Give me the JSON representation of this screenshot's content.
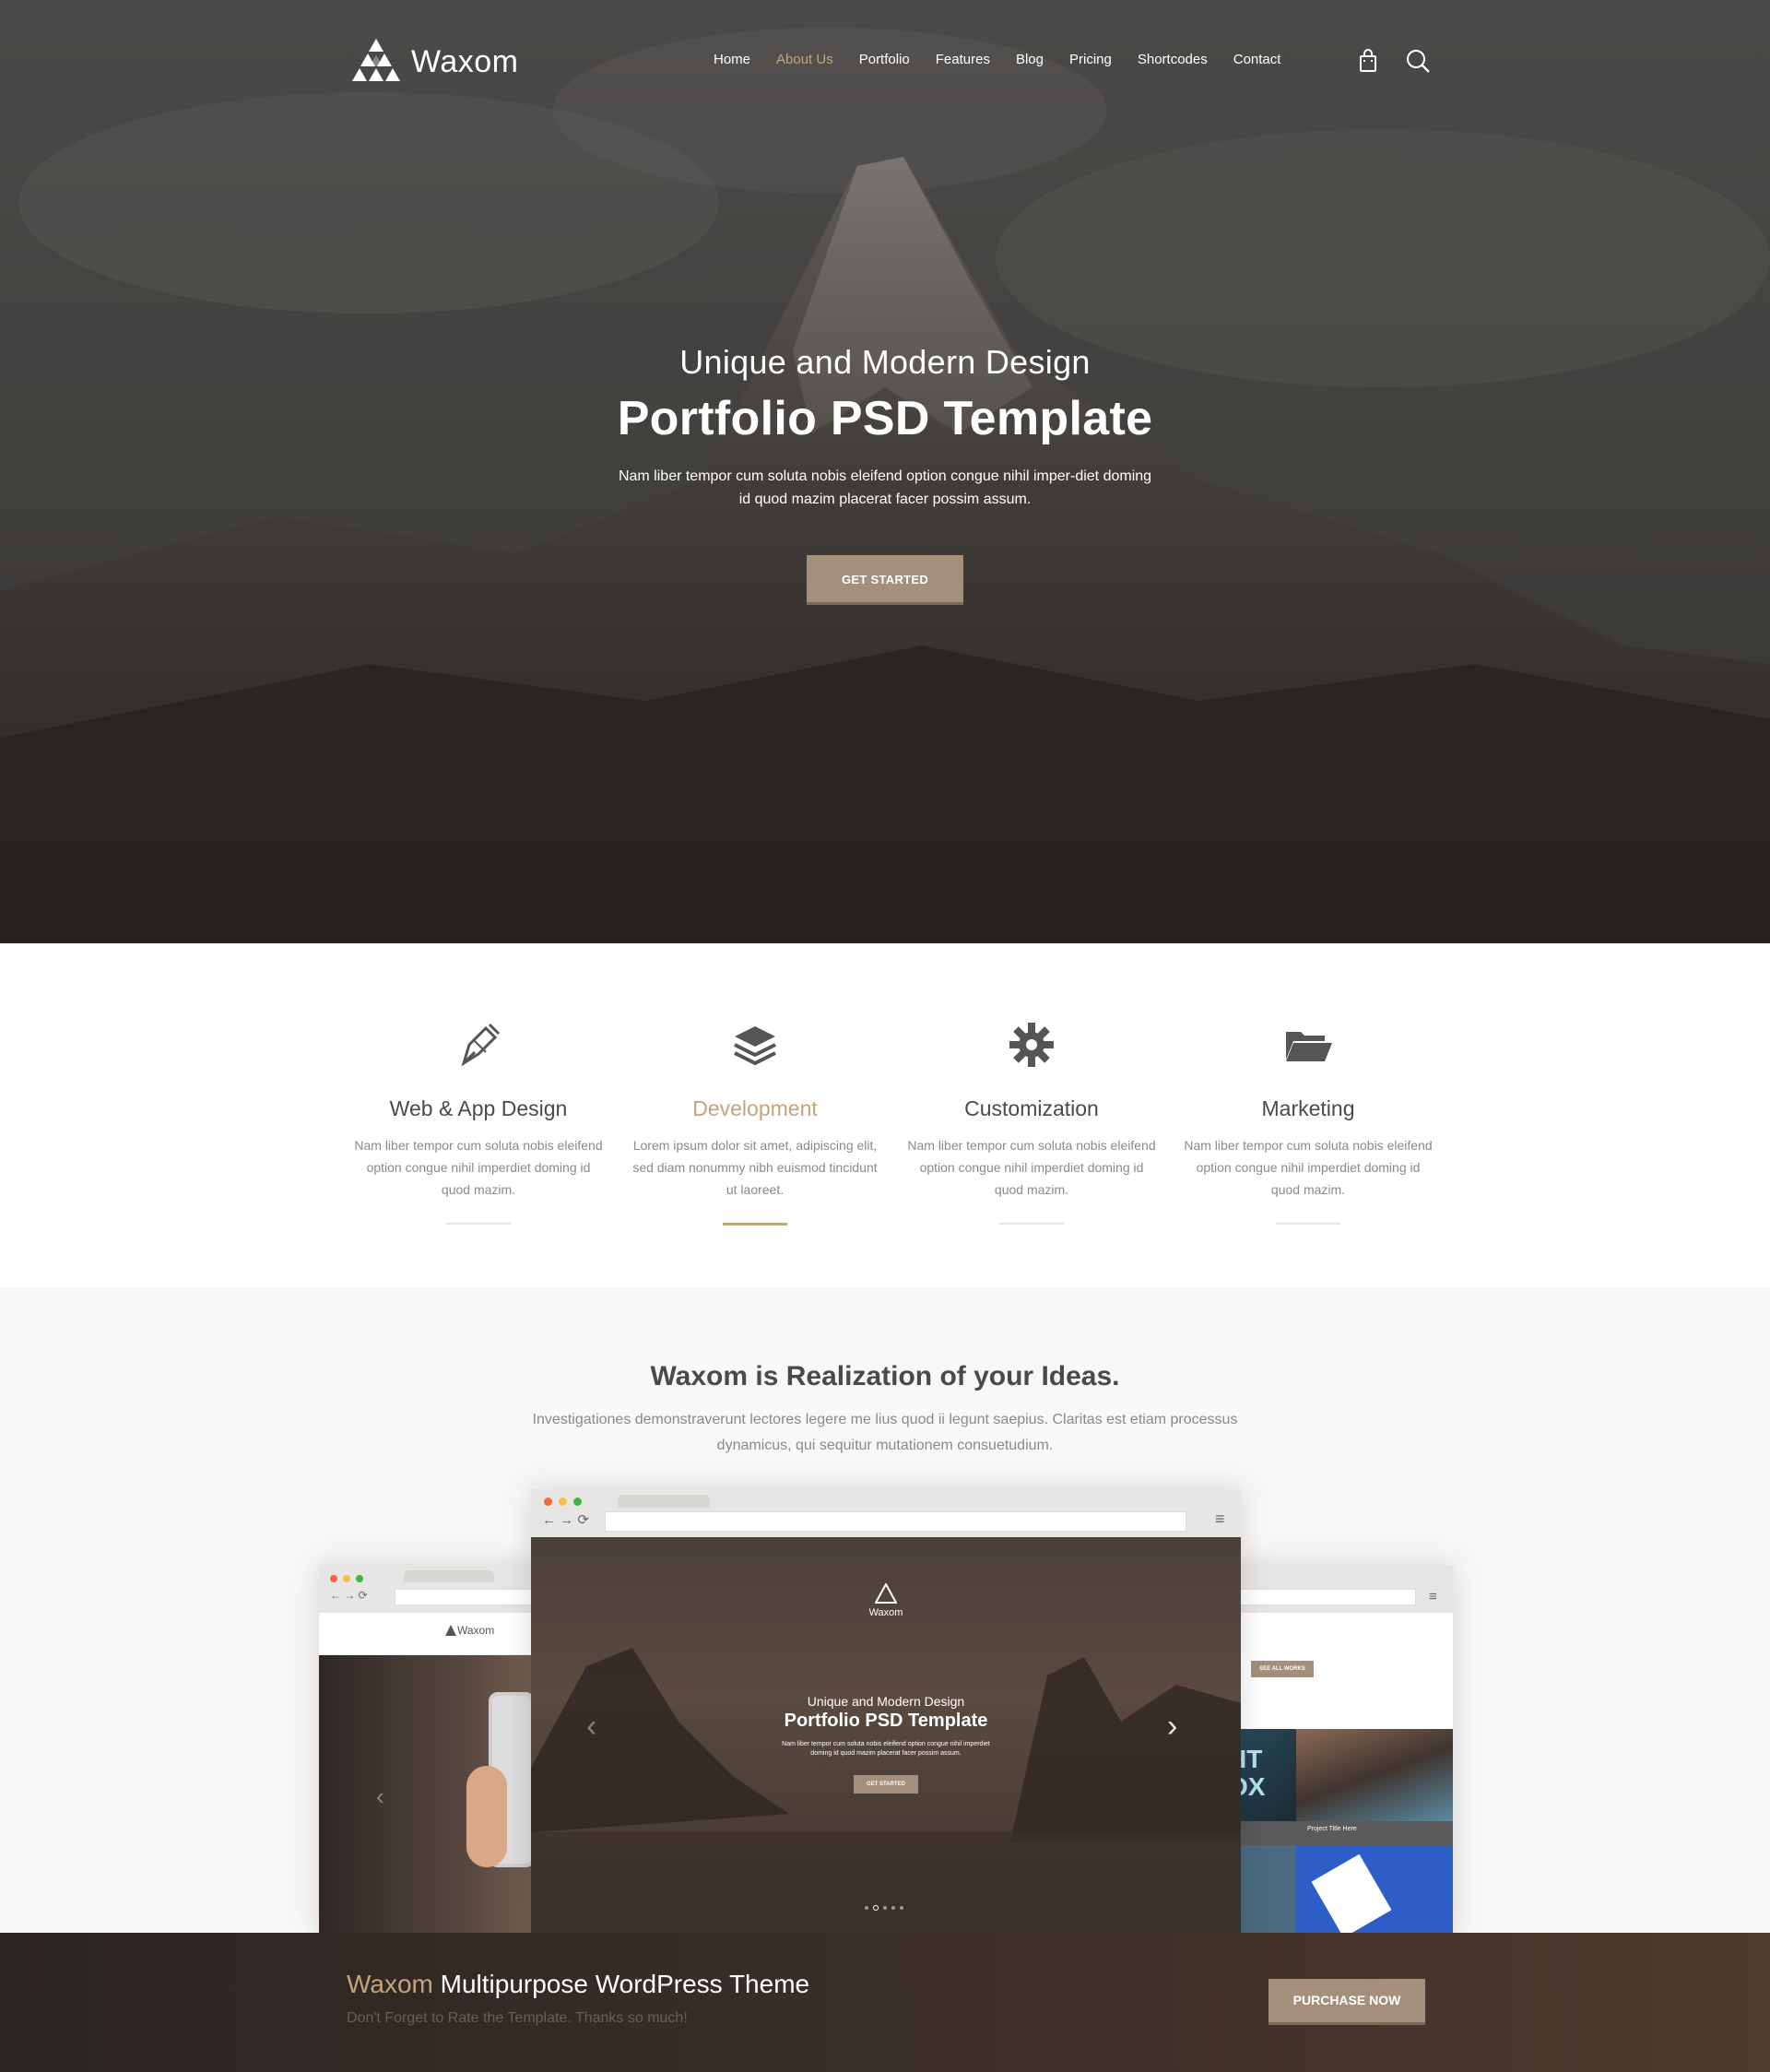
{
  "brand": {
    "name": "Waxom"
  },
  "nav": {
    "items": [
      "Home",
      "About Us",
      "Portfolio",
      "Features",
      "Blog",
      "Pricing",
      "Shortcodes",
      "Contact"
    ],
    "active_index": 1,
    "icons": [
      "shopping-bag-icon",
      "search-icon"
    ]
  },
  "hero": {
    "pretitle": "Unique and Modern Design",
    "title": "Portfolio PSD Template",
    "description": "Nam liber tempor cum soluta nobis eleifend option congue nihil imper-diet doming id quod mazim placerat facer possim assum.",
    "cta_label": "GET STARTED"
  },
  "features": [
    {
      "icon": "pen-nib-icon",
      "title": "Web & App Design",
      "desc": "Nam liber tempor cum soluta nobis eleifend option congue nihil imperdiet doming id quod mazim.",
      "active": false
    },
    {
      "icon": "layers-icon",
      "title": "Development",
      "desc": "Lorem ipsum dolor sit amet, adipiscing elit, sed diam nonummy nibh euismod tincidunt ut laoreet.",
      "active": true
    },
    {
      "icon": "gear-icon",
      "title": "Customization",
      "desc": "Nam liber tempor cum soluta nobis eleifend option congue nihil imperdiet doming id quod mazim.",
      "active": false
    },
    {
      "icon": "folder-open-icon",
      "title": "Marketing",
      "desc": "Nam liber tempor cum soluta nobis eleifend option congue nihil imperdiet doming id quod mazim.",
      "active": false
    }
  ],
  "showcase": {
    "title": "Waxom is Realization of your Ideas.",
    "description": "Investigationes demonstraverunt lectores legere me lius quod ii legunt saepius. Claritas est etiam processus dynamicus, qui sequitur mutationem consuetudium.",
    "main_browser": {
      "logo_text": "Waxom",
      "pretitle": "Unique and Modern Design",
      "title": "Portfolio PSD Template",
      "desc": "Nam liber tempor cum soluta nobis eleifend option congue nihil imperdiet doming id quod mazim placerat facer possim assum.",
      "button": "GET STARTED"
    },
    "left_browser": {
      "logo_text": "Waxom"
    },
    "right_browser": {
      "button": "SEE ALL WORKS",
      "project_title": "Project Title Here",
      "project_letters": "HT\nOX"
    }
  },
  "cta": {
    "brand": "Waxom",
    "title_rest": " Multipurpose WordPress Theme",
    "subtitle": "Don't Forget to Rate the Template. Thanks so much!",
    "button": "PURCHASE NOW"
  },
  "colors": {
    "accent": "#c4a47c",
    "button": "#a38f7b"
  }
}
